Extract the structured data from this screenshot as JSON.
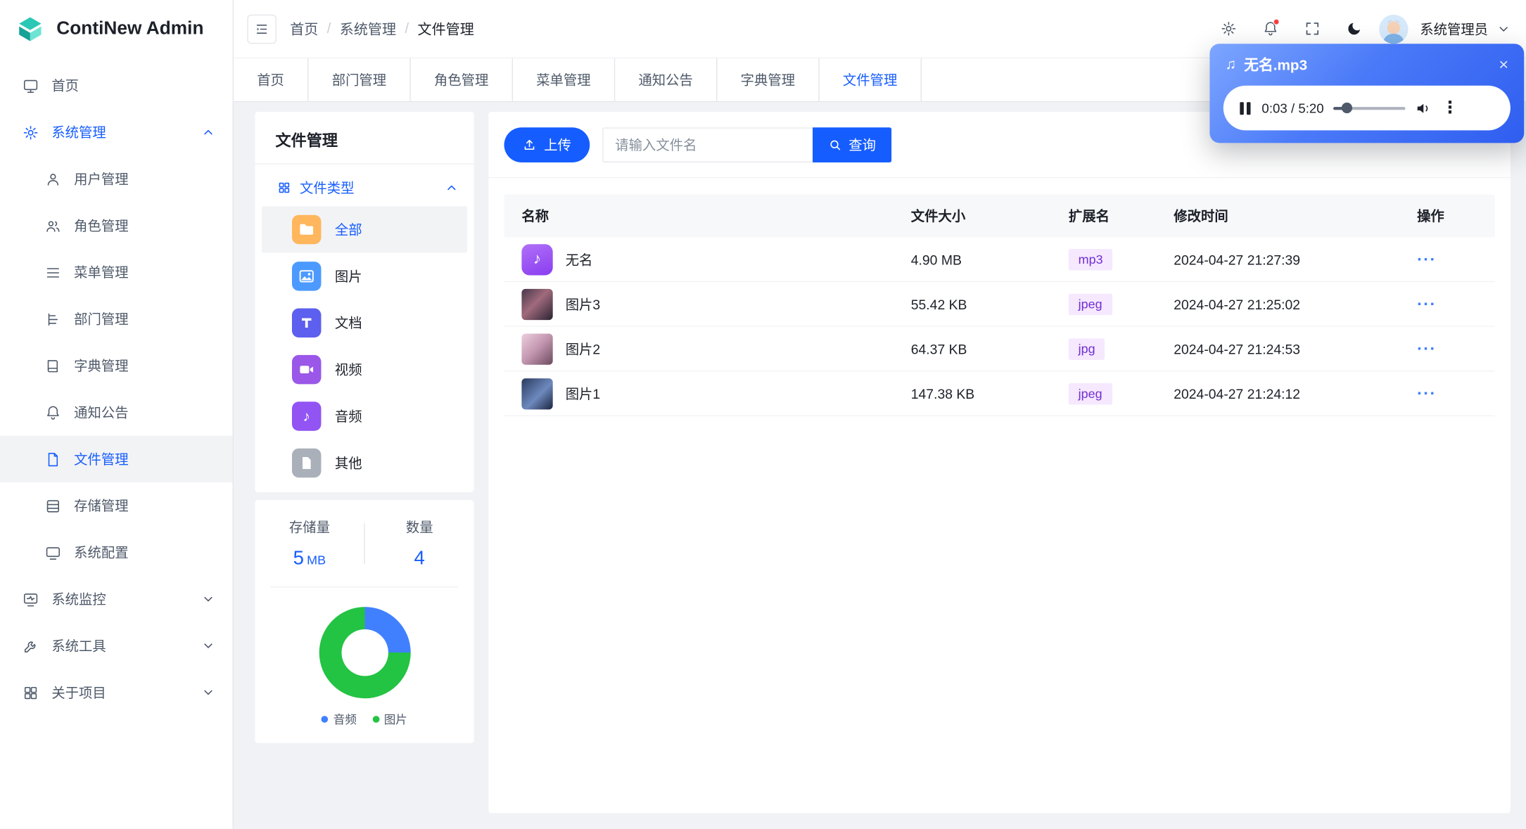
{
  "app": {
    "name": "ContiNew Admin",
    "primary_color": "#165dff"
  },
  "header": {
    "breadcrumb": {
      "items": [
        "首页",
        "系统管理",
        "文件管理"
      ],
      "separator": "/"
    },
    "user": {
      "name": "系统管理员"
    }
  },
  "sidebar": {
    "home": "首页",
    "system": "系统管理",
    "children": [
      "用户管理",
      "角色管理",
      "菜单管理",
      "部门管理",
      "字典管理",
      "通知公告",
      "文件管理",
      "存储管理",
      "系统配置"
    ],
    "active_child": "文件管理",
    "monitor": "系统监控",
    "tools": "系统工具",
    "about": "关于项目"
  },
  "tabs": {
    "items": [
      "首页",
      "部门管理",
      "角色管理",
      "菜单管理",
      "通知公告",
      "字典管理",
      "文件管理"
    ],
    "active": "文件管理"
  },
  "panel": {
    "title": "文件管理",
    "group": "文件类型",
    "types": [
      "全部",
      "图片",
      "文档",
      "视频",
      "音频",
      "其他"
    ],
    "active_type": "全部",
    "stats": {
      "storage_label": "存储量",
      "storage_value": "5",
      "storage_unit": "MB",
      "count_label": "数量",
      "count_value": "4"
    }
  },
  "toolbar": {
    "upload": "上传",
    "search_placeholder": "请输入文件名",
    "query": "查询"
  },
  "table": {
    "headers": [
      "名称",
      "文件大小",
      "扩展名",
      "修改时间",
      "操作"
    ],
    "rows": [
      {
        "name": "无名",
        "size": "4.90 MB",
        "ext": "mp3",
        "time": "2024-04-27 21:27:39"
      },
      {
        "name": "图片3",
        "size": "55.42 KB",
        "ext": "jpeg",
        "time": "2024-04-27 21:25:02"
      },
      {
        "name": "图片2",
        "size": "64.37 KB",
        "ext": "jpg",
        "time": "2024-04-27 21:24:53"
      },
      {
        "name": "图片1",
        "size": "147.38 KB",
        "ext": "jpeg",
        "time": "2024-04-27 21:24:12"
      }
    ],
    "more_label": "···"
  },
  "player": {
    "title": "无名.mp3",
    "time": "0:03 / 5:20",
    "progress_percent": 18
  },
  "chart_data": {
    "type": "pie",
    "donut": true,
    "segments": [
      {
        "label": "音频",
        "value": 1,
        "color": "#4080ff"
      },
      {
        "label": "图片",
        "value": 3,
        "color": "#23c343"
      }
    ],
    "legend_position": "bottom"
  },
  "glyphs": {
    "music_note": "♪",
    "double_note": "♫",
    "close": "×",
    "dots_vertical": "⋮"
  },
  "colors": {
    "badge_bg": "#f5e8ff",
    "badge_text": "#722ed1",
    "notification": "#f53f3f"
  }
}
